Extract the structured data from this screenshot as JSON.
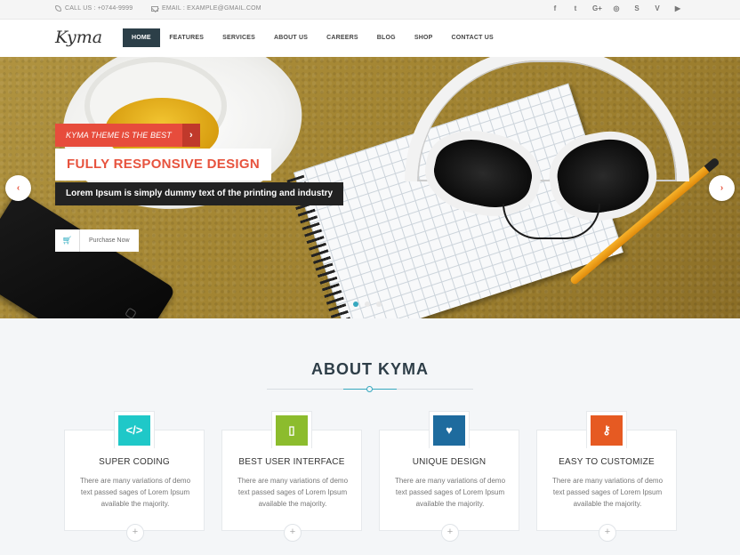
{
  "topbar": {
    "phone_label": "CALL US : +0744-9999",
    "email_label": "EMAIL : EXAMPLE@GMAIL.COM",
    "social_icons": [
      "facebook-icon",
      "twitter-icon",
      "google-plus-icon",
      "dribbble-icon",
      "skype-icon",
      "vimeo-icon",
      "youtube-icon"
    ],
    "social_glyphs": [
      "f",
      "t",
      "G+",
      "◎",
      "S",
      "V",
      "▶"
    ]
  },
  "header": {
    "logo": "Kyma",
    "nav": [
      "HOME",
      "FEATURES",
      "SERVICES",
      "ABOUT US",
      "CAREERS",
      "BLOG",
      "SHOP",
      "CONTACT US"
    ],
    "active_nav": "HOME"
  },
  "hero": {
    "badge": "KYMA THEME IS THE BEST",
    "badge_arrow": "›",
    "headline": "FULLY RESPONSIVE DESIGN",
    "subline": "Lorem Ipsum is simply dummy text of the printing and industry",
    "purchase_label": "Purchase Now",
    "slide_count": 3,
    "active_slide": 1
  },
  "about": {
    "title": "ABOUT KYMA",
    "cards": [
      {
        "title": "SUPER CODING",
        "text": "There are many variations of demo text passed sages of Lorem Ipsum available the majority.",
        "icon": "code-icon",
        "glyph": "</>",
        "color": "#1fc8c8"
      },
      {
        "title": "BEST USER INTERFACE",
        "text": "There are many variations of demo text passed sages of Lorem Ipsum available the majority.",
        "icon": "mobile-icon",
        "glyph": "▯",
        "color": "#8cbc2d"
      },
      {
        "title": "UNIQUE DESIGN",
        "text": "There are many variations of demo text passed sages of Lorem Ipsum available the majority.",
        "icon": "heart-icon",
        "glyph": "♥",
        "color": "#1e6b9e"
      },
      {
        "title": "EASY TO CUSTOMIZE",
        "text": "There are many variations of demo text passed sages of Lorem Ipsum available the majority.",
        "icon": "key-icon",
        "glyph": "⚷",
        "color": "#e65a22"
      }
    ]
  },
  "colors": {
    "accent": "#e7533e",
    "teal": "#37a8bf",
    "nav_active": "#2c3f48"
  }
}
